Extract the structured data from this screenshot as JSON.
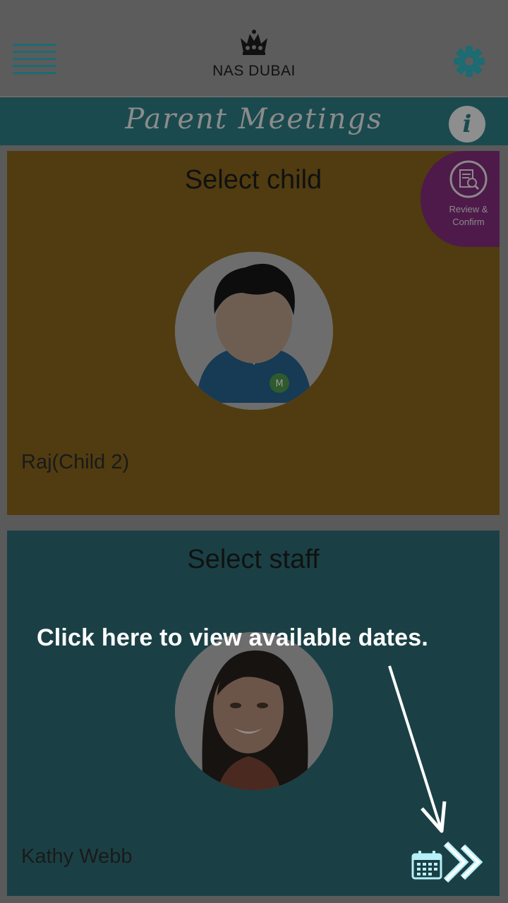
{
  "header": {
    "logo_text": "NAS DUBAI",
    "menu_icon": "hamburger-menu-icon",
    "settings_icon": "gear-icon"
  },
  "title_bar": {
    "title": "Parent Meetings",
    "info_label": "i"
  },
  "review_badge": {
    "label_line1": "Review &",
    "label_line2": "Confirm",
    "icon": "document-magnifier-icon"
  },
  "child_section": {
    "title": "Select child",
    "child_name": "Raj(Child 2)",
    "avatar": "child-avatar-icon"
  },
  "staff_section": {
    "title": "Select staff",
    "staff_name": "Kathy Webb",
    "avatar": "staff-photo"
  },
  "overlay": {
    "hint": "Click here to view available dates."
  },
  "colors": {
    "teal": "#1a4a4e",
    "gold_dimmed": "#503c10",
    "purple_dimmed": "#4e1a4a",
    "accent_cyan": "#b8f0f8"
  }
}
